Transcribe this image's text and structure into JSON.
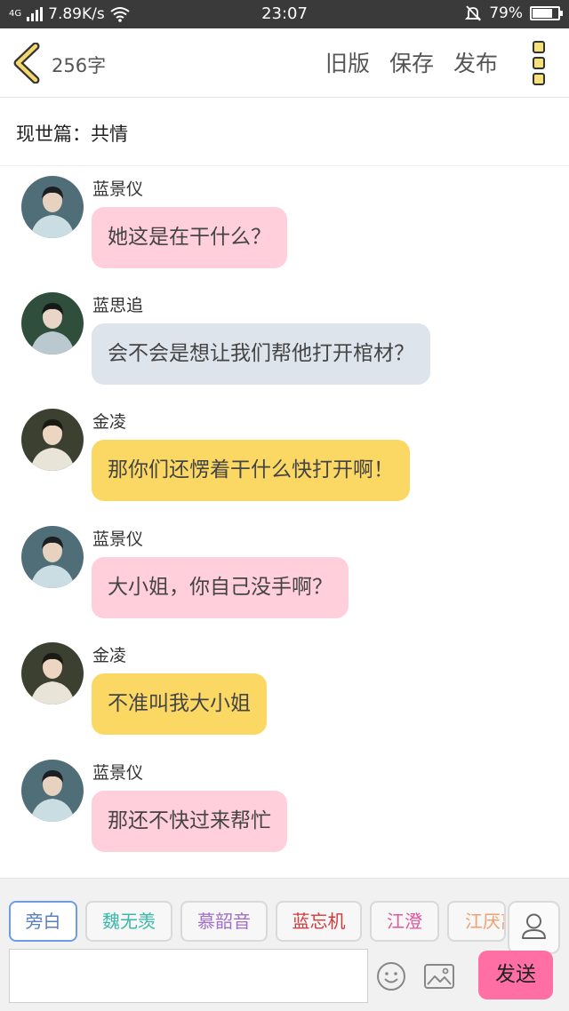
{
  "status_bar": {
    "network": "4G",
    "speed": "7.89K/s",
    "time": "23:07",
    "battery": "79%",
    "battery_level": 0.79,
    "icons": [
      "signal-icon",
      "wifi-icon",
      "bell-muted-icon",
      "battery-icon"
    ]
  },
  "toolbar": {
    "word_count": "256字",
    "old_version_label": "旧版",
    "save_label": "保存",
    "publish_label": "发布"
  },
  "chapter": {
    "title": "现世篇：共情"
  },
  "messages": [
    {
      "sender": "蓝景仪",
      "text": "她这是在干什么？",
      "style": "pink"
    },
    {
      "sender": "蓝思追",
      "text": "会不会是想让我们帮他打开棺材？",
      "style": "gray"
    },
    {
      "sender": "金凌",
      "text": "那你们还愣着干什么快打开啊！",
      "style": "yellow"
    },
    {
      "sender": "蓝景仪",
      "text": "大小姐，你自己没手啊？",
      "style": "pink"
    },
    {
      "sender": "金凌",
      "text": "不准叫我大小姐",
      "style": "yellow"
    },
    {
      "sender": "蓝景仪",
      "text": "那还不快过来帮忙",
      "style": "pink"
    }
  ],
  "colors": {
    "pink_bubble": "#ffd0dc",
    "gray_bubble": "#dde4ec",
    "yellow_bubble": "#fbd864",
    "send_button": "#ff6fa4"
  },
  "characters": [
    {
      "label": "旁白",
      "color": "#5a7fc0"
    },
    {
      "label": "魏无羡",
      "color": "#3bb8a8"
    },
    {
      "label": "慕韶音",
      "color": "#a070c8"
    },
    {
      "label": "蓝忘机",
      "color": "#d23a3a"
    },
    {
      "label": "江澄",
      "color": "#e0569a"
    },
    {
      "label": "江厌离",
      "color": "#f0a070"
    }
  ],
  "input": {
    "value": "",
    "placeholder": ""
  },
  "send_label": "发送"
}
